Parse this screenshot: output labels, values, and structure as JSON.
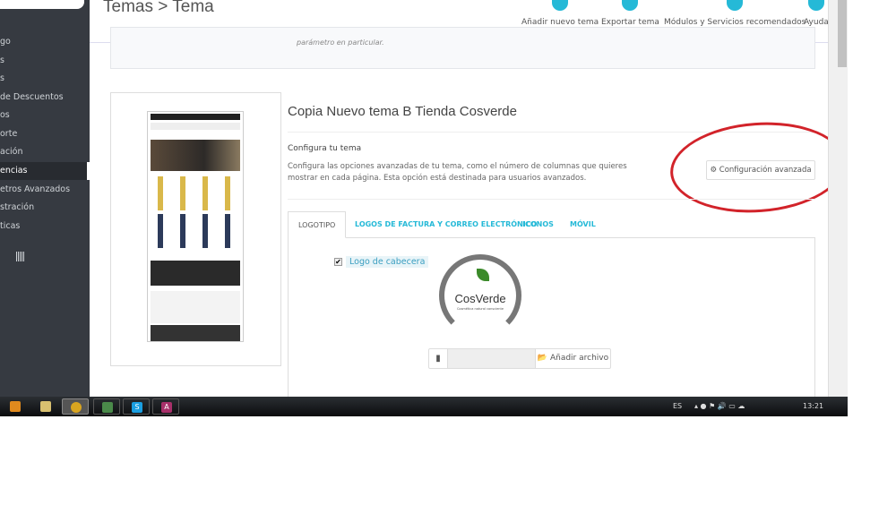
{
  "header": {
    "title": "Temas > Tema",
    "toolbar": [
      {
        "label": "Añadir nuevo tema",
        "icon": "plus-circle-icon"
      },
      {
        "label": "Exportar tema",
        "icon": "export-icon"
      },
      {
        "label": "Módulos y Servicios recomendados",
        "icon": "puzzle-icon"
      },
      {
        "label": "Ayuda",
        "icon": "help-icon"
      }
    ]
  },
  "sidebar": {
    "items": [
      "go",
      "s",
      "s",
      "de Descuentos",
      "os",
      "orte",
      "ación",
      "encias",
      "etros Avanzados",
      "stración",
      "ticas"
    ],
    "active": 7
  },
  "info": {
    "text": "parámetro en particular."
  },
  "theme": {
    "title": "Copia Nuevo tema B Tienda Cosverde",
    "configure_title": "Configura tu tema",
    "configure_desc": "Configura las opciones avanzadas de tu tema, como el número de columnas que quieres mostrar en cada página. Esta opción está destinada para usuarios avanzados.",
    "advanced_button": "Configuración avanzada"
  },
  "tabs": [
    "LOGOTIPO",
    "LOGOS DE FACTURA Y CORREO ELECTRÓNICO",
    "ICONOS",
    "MÓVIL"
  ],
  "logo": {
    "checkbox_label": "Logo de cabecera",
    "checked": true,
    "logo_name": "CosVerde",
    "logo_tagline": "Cosmética natural consciente",
    "add_file": "Añadir archivo"
  },
  "taskbar": {
    "lang": "ES",
    "time": "13:21",
    "accent": "#25b9d7"
  }
}
